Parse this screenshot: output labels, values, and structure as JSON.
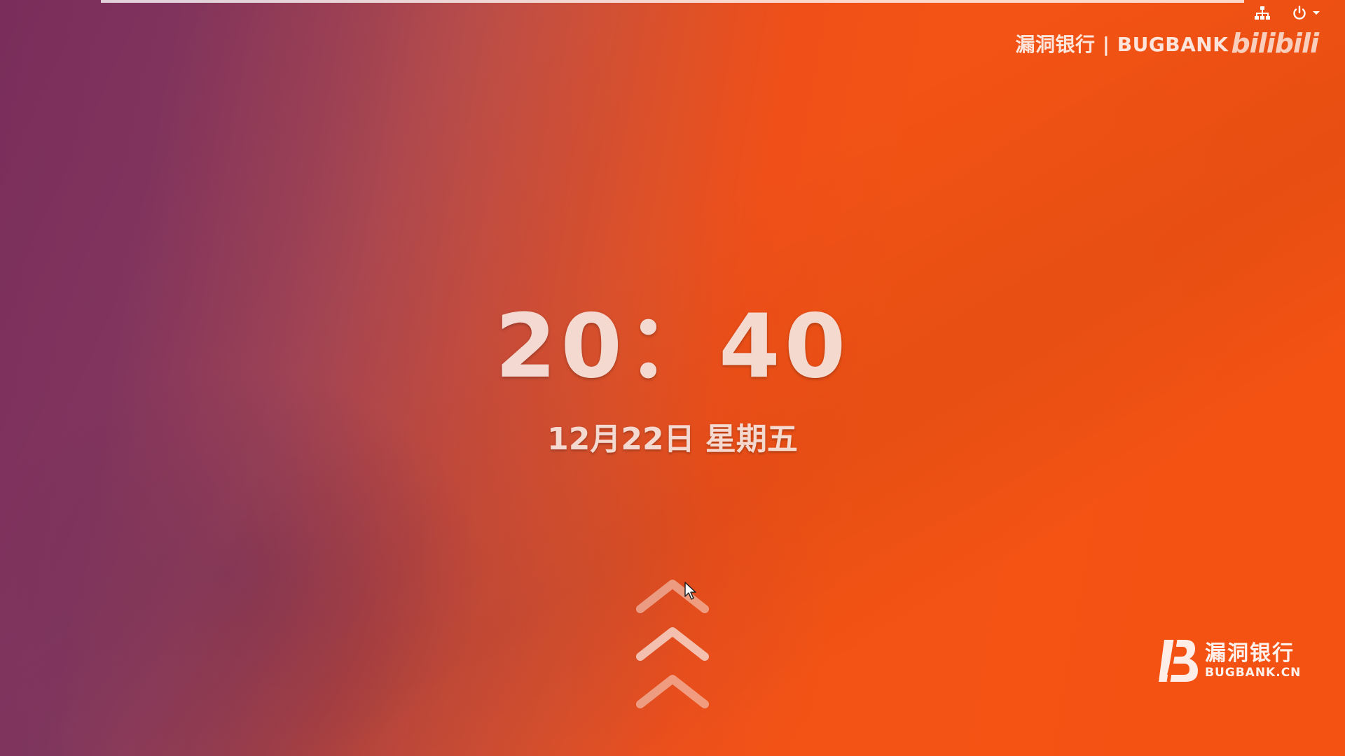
{
  "lock_screen": {
    "time": "20：40",
    "date": "12月22日 星期五",
    "unlock_hint_icon": "chevron-up-triple-icon"
  },
  "top_bar": {
    "network_icon": "network-wired-icon",
    "power_icon": "power-icon",
    "menu_arrow_icon": "chevron-down-icon"
  },
  "watermark": {
    "text": "漏洞银行 | BUGBANK",
    "bilibili": "bilibili"
  },
  "brand": {
    "name_cn": "漏洞银行",
    "name_en": "BUGBANK.CN"
  },
  "colors": {
    "background_orange": "#f45213",
    "background_purple": "#7a2d5a",
    "text": "#f8e2da"
  }
}
